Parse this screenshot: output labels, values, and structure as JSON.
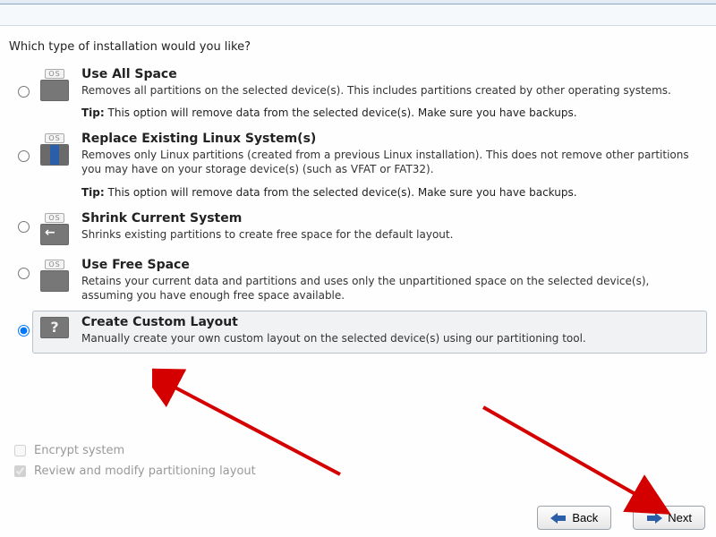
{
  "prompt": "Which type of installation would you like?",
  "options": [
    {
      "title": "Use All Space",
      "desc": "Removes all partitions on the selected device(s).  This includes partitions created by other operating systems.",
      "tip_label": "Tip:",
      "tip": "This option will remove data from the selected device(s).  Make sure you have backups."
    },
    {
      "title": "Replace Existing Linux System(s)",
      "desc": "Removes only Linux partitions (created from a previous Linux installation).  This does not remove other partitions you may have on your storage device(s) (such as VFAT or FAT32).",
      "tip_label": "Tip:",
      "tip": "This option will remove data from the selected device(s).  Make sure you have backups."
    },
    {
      "title": "Shrink Current System",
      "desc": "Shrinks existing partitions to create free space for the default layout."
    },
    {
      "title": "Use Free Space",
      "desc": "Retains your current data and partitions and uses only the unpartitioned space on the selected device(s), assuming you have enough free space available."
    },
    {
      "title": "Create Custom Layout",
      "desc": "Manually create your own custom layout on the selected device(s) using our partitioning tool."
    }
  ],
  "selected_index": 4,
  "checks": {
    "encrypt_label": "Encrypt system",
    "review_label": "Review and modify partitioning layout",
    "encrypt_checked": false,
    "review_checked": true
  },
  "buttons": {
    "back": "Back",
    "next": "Next"
  },
  "os_tag": "OS",
  "qmark": "?"
}
